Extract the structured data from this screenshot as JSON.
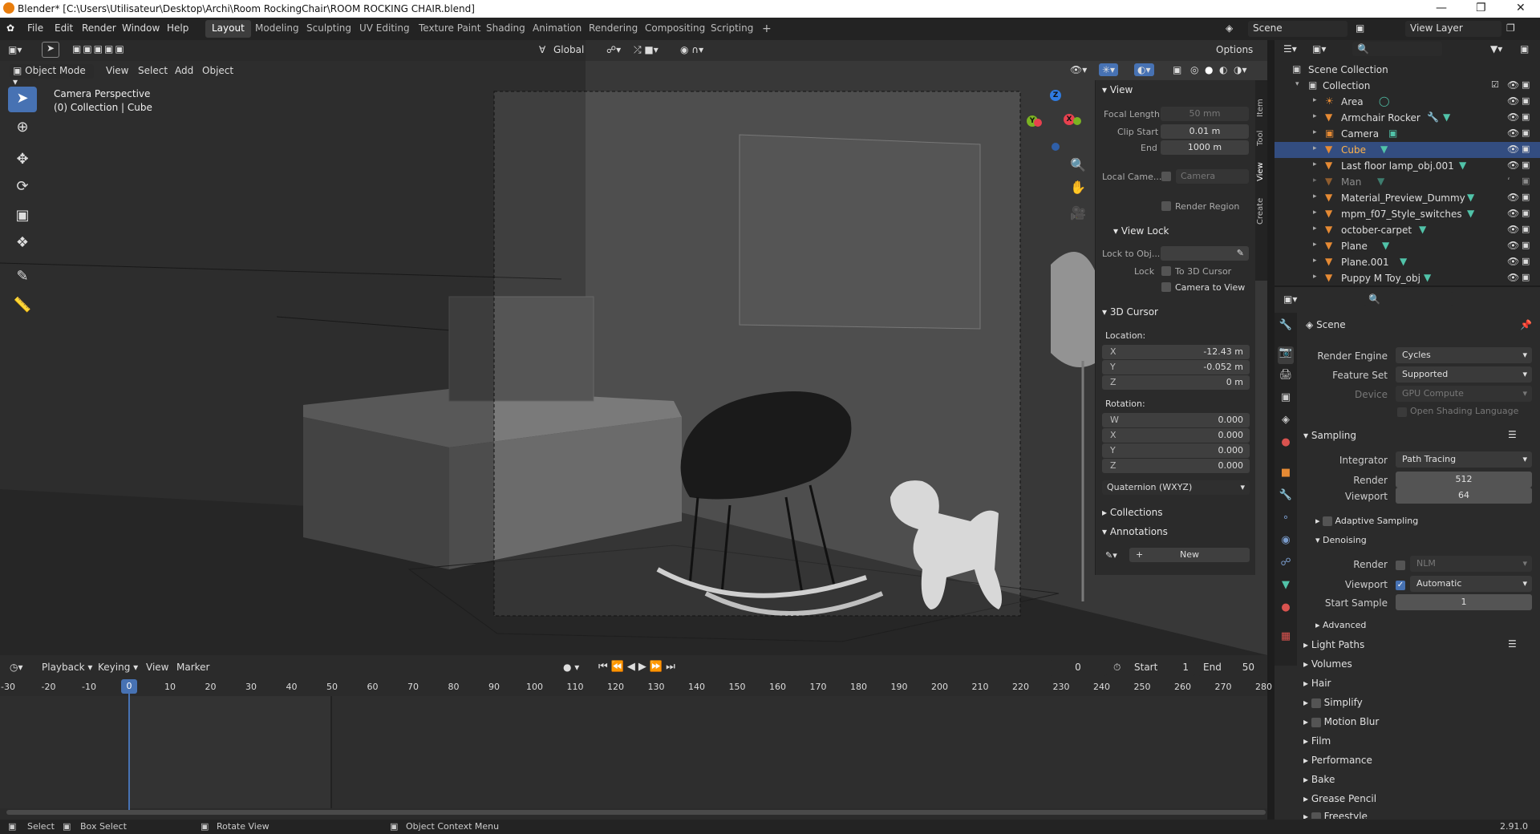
{
  "window": {
    "title": "Blender* [C:\\Users\\Utilisateur\\Desktop\\Archi\\Room RockingChair\\ROOM ROCKING CHAIR.blend]"
  },
  "menubar": {
    "menus": [
      "File",
      "Edit",
      "Render",
      "Window",
      "Help"
    ],
    "workspaces": [
      "Layout",
      "Modeling",
      "Sculpting",
      "UV Editing",
      "Texture Paint",
      "Shading",
      "Animation",
      "Rendering",
      "Compositing",
      "Scripting"
    ],
    "active_workspace": "Layout",
    "scene": "Scene",
    "view_layer": "View Layer"
  },
  "viewport": {
    "mode": "Object Mode",
    "menus": [
      "View",
      "Select",
      "Add",
      "Object"
    ],
    "orientation": "Global",
    "options_label": "Options",
    "overlay_line1": "Camera Perspective",
    "overlay_line2": "(0) Collection | Cube"
  },
  "npanel": {
    "tabs": [
      "Item",
      "Tool",
      "View",
      "Create"
    ],
    "view_header": "View",
    "focal_length_label": "Focal Length",
    "focal_length": "50 mm",
    "clip_start_label": "Clip Start",
    "clip_start": "0.01 m",
    "end_label": "End",
    "end": "1000 m",
    "local_camera_label": "Local Came...",
    "local_camera": "Camera",
    "render_region": "Render Region",
    "view_lock_header": "View Lock",
    "lock_to_obj_label": "Lock to Obj...",
    "lock_label": "Lock",
    "to_3d_cursor": "To 3D Cursor",
    "camera_to_view": "Camera to View",
    "cursor_header": "3D Cursor",
    "location_label": "Location:",
    "loc_x": "-12.43 m",
    "loc_y": "-0.052 m",
    "loc_z": "0 m",
    "rotation_label": "Rotation:",
    "rot_w": "0.000",
    "rot_x": "0.000",
    "rot_y": "0.000",
    "rot_z": "0.000",
    "rotation_mode": "Quaternion (WXYZ)",
    "collections_header": "Collections",
    "annotations_header": "Annotations",
    "new_label": "New"
  },
  "outliner": {
    "scene_collection": "Scene Collection",
    "collection": "Collection",
    "items": [
      "Area",
      "Armchair Rocker",
      "Camera",
      "Cube",
      "Last floor lamp_obj.001",
      "Man",
      "Material_Preview_Dummy",
      "mpm_f07_Style_switches",
      "october-carpet",
      "Plane",
      "Plane.001",
      "Puppy M Toy_obj"
    ],
    "selected": "Cube"
  },
  "properties": {
    "context": "Scene",
    "render_engine_label": "Render Engine",
    "render_engine": "Cycles",
    "feature_set_label": "Feature Set",
    "feature_set": "Supported",
    "device_label": "Device",
    "device": "GPU Compute",
    "osl": "Open Shading Language",
    "sampling_header": "Sampling",
    "integrator_label": "Integrator",
    "integrator": "Path Tracing",
    "render_label": "Render",
    "render_samples": "512",
    "viewport_label": "Viewport",
    "viewport_samples": "64",
    "adaptive_sampling": "Adaptive Sampling",
    "denoising_header": "Denoising",
    "denoise_render_label": "Render",
    "denoise_render": "NLM",
    "denoise_viewport_label": "Viewport",
    "denoise_viewport": "Automatic",
    "start_sample_label": "Start Sample",
    "start_sample": "1",
    "advanced": "Advanced",
    "sections": [
      "Light Paths",
      "Volumes",
      "Hair",
      "Simplify",
      "Motion Blur",
      "Film",
      "Performance",
      "Bake",
      "Grease Pencil",
      "Freestyle"
    ]
  },
  "timeline": {
    "menus": [
      "Playback",
      "Keying",
      "View",
      "Marker"
    ],
    "current_frame": "0",
    "start_label": "Start",
    "start": "1",
    "end_label": "End",
    "end": "50",
    "ticks": [
      "-30",
      "-20",
      "-10",
      "0",
      "10",
      "20",
      "30",
      "40",
      "50",
      "60",
      "70",
      "80",
      "90",
      "100",
      "110",
      "120",
      "130",
      "140",
      "150",
      "160",
      "170",
      "180",
      "190",
      "200",
      "210",
      "220",
      "230",
      "240",
      "250",
      "260",
      "270",
      "280"
    ]
  },
  "statusbar": {
    "select": "Select",
    "box_select": "Box Select",
    "rotate_view": "Rotate View",
    "context_menu": "Object Context Menu",
    "version": "2.91.0"
  },
  "colors": {
    "accent": "#4772b3",
    "selected_row": "#334d80",
    "object_icon": "#e58a34"
  }
}
